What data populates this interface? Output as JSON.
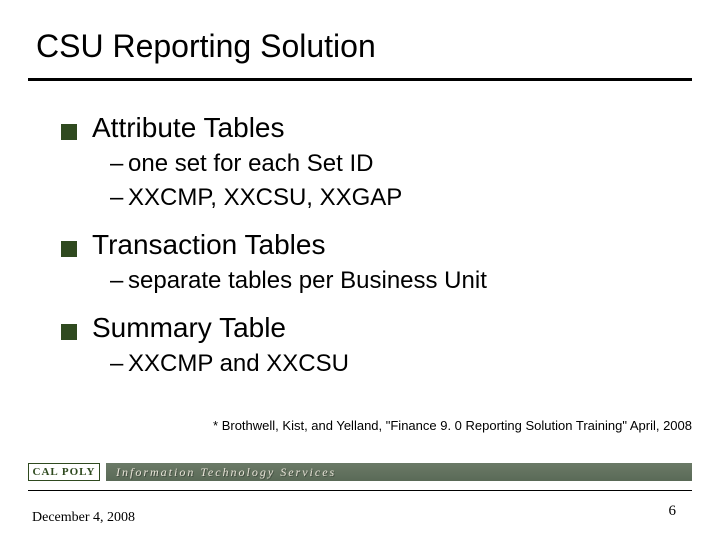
{
  "title": "CSU Reporting Solution",
  "bullets": [
    {
      "label": "Attribute Tables",
      "sub": [
        "one set for each Set ID",
        "XXCMP, XXCSU, XXGAP"
      ]
    },
    {
      "label": "Transaction Tables",
      "sub": [
        "separate tables per Business Unit"
      ]
    },
    {
      "label": "Summary Table",
      "sub": [
        "XXCMP and XXCSU"
      ]
    }
  ],
  "footnote": "* Brothwell, Kist, and Yelland, \"Finance 9. 0 Reporting Solution Training\" April, 2008",
  "logo": {
    "calpoly": "CAL POLY",
    "its": "Information Technology Services"
  },
  "footer": {
    "date": "December 4, 2008",
    "page": "6"
  }
}
